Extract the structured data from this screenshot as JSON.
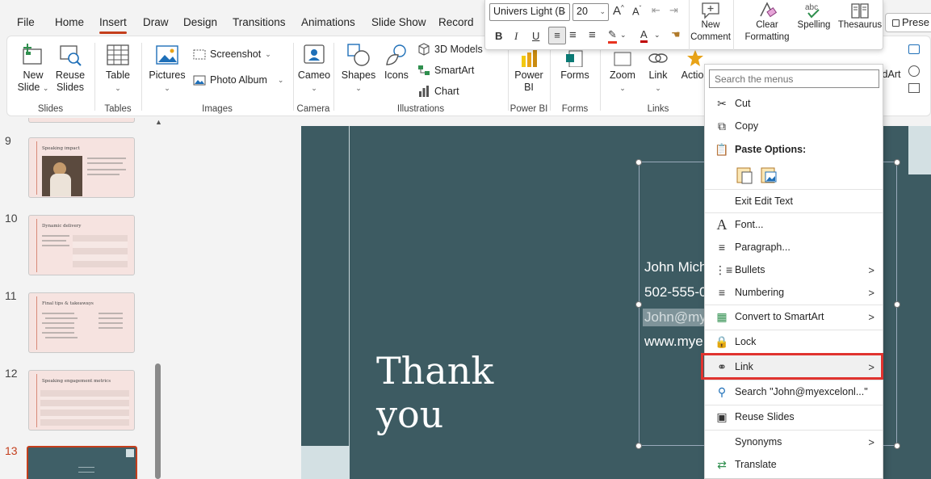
{
  "menubar": {
    "tabs": [
      "File",
      "Home",
      "Insert",
      "Draw",
      "Design",
      "Transitions",
      "Animations",
      "Slide Show",
      "Record"
    ],
    "active": "Insert",
    "present": "Prese"
  },
  "ribbon": {
    "slides": {
      "new_slide": "New Slide",
      "reuse_slides": "Reuse Slides",
      "label": "Slides"
    },
    "tables": {
      "table": "Table",
      "label": "Tables"
    },
    "images": {
      "pictures": "Pictures",
      "screenshot": "Screenshot",
      "photo_album": "Photo Album",
      "label": "Images"
    },
    "camera": {
      "cameo": "Cameo",
      "label": "Camera"
    },
    "illustrations": {
      "shapes": "Shapes",
      "icons": "Icons",
      "models": "3D Models",
      "smartart": "SmartArt",
      "chart": "Chart",
      "label": "Illustrations"
    },
    "powerbi": {
      "powerbi": "Power BI",
      "label": "Power BI"
    },
    "forms": {
      "forms": "Forms",
      "label": "Forms"
    },
    "links": {
      "zoom": "Zoom",
      "link": "Link",
      "action": "Action",
      "label": "Links"
    },
    "partial": {
      "dart": "dArt"
    }
  },
  "minibar": {
    "font": "Univers Light (B",
    "size": "20",
    "new_comment": "New Comment",
    "clear_formatting": "Clear Formatting",
    "spelling": "Spelling",
    "thesaurus": "Thesaurus"
  },
  "thumbnails": [
    {
      "num": "9",
      "title": "Speaking impact"
    },
    {
      "num": "10",
      "title": "Dynamic delivery"
    },
    {
      "num": "11",
      "title": "Final tips & takeaways"
    },
    {
      "num": "12",
      "title": "Speaking engagement metrics"
    },
    {
      "num": "13",
      "title": ""
    }
  ],
  "slide": {
    "thankyou_line1": "Thank",
    "thankyou_line2": "you",
    "name": "John Mich",
    "phone": "502-555-0",
    "email": "John@my",
    "web": "www.mye"
  },
  "context_menu": {
    "search_placeholder": "Search the menus",
    "items": {
      "cut": "Cut",
      "copy": "Copy",
      "paste_options": "Paste Options:",
      "exit_edit_text": "Exit Edit Text",
      "font": "Font...",
      "paragraph": "Paragraph...",
      "bullets": "Bullets",
      "numbering": "Numbering",
      "convert_smartart": "Convert to SmartArt",
      "lock": "Lock",
      "link": "Link",
      "search": "Search \"John@myexcelonl...\"",
      "reuse_slides": "Reuse Slides",
      "synonyms": "Synonyms",
      "translate": "Translate"
    }
  },
  "colors": {
    "accent": "#c43e1c",
    "slide_bg": "#3d5b62",
    "highlight": "#e0332f"
  }
}
